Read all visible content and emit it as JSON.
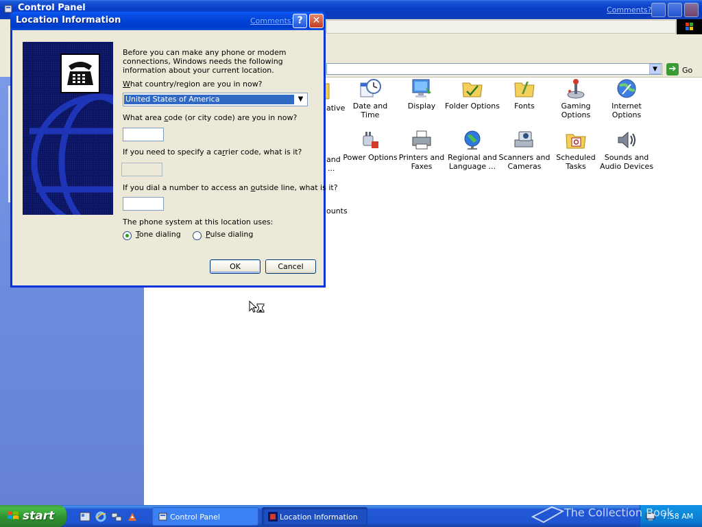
{
  "control_panel": {
    "title": "Control Panel",
    "comments_link": "Comments?",
    "go_label": "Go",
    "icons": [
      {
        "label": "Date and Time",
        "icon": "clock-icon"
      },
      {
        "label": "Display",
        "icon": "monitor-icon"
      },
      {
        "label": "Folder Options",
        "icon": "folder-icon"
      },
      {
        "label": "Fonts",
        "icon": "fonts-folder-icon"
      },
      {
        "label": "Gaming Options",
        "icon": "joystick-icon"
      },
      {
        "label": "Internet Options",
        "icon": "globe-network-icon"
      },
      {
        "label": "Power Options",
        "icon": "power-plug-icon"
      },
      {
        "label": "Printers and Faxes",
        "icon": "printer-icon"
      },
      {
        "label": "Regional and Language ...",
        "icon": "globe-icon"
      },
      {
        "label": "Scanners and Cameras",
        "icon": "scanner-icon"
      },
      {
        "label": "Scheduled Tasks",
        "icon": "calendar-folder-icon"
      },
      {
        "label": "Sounds and Audio Devices",
        "icon": "speaker-icon"
      }
    ],
    "partial_labels": {
      "row1": "ative",
      "row2a": "and",
      "row2b": "...",
      "row3": "ounts"
    }
  },
  "dialog": {
    "title": "Location Information",
    "comments_link": "Comments?",
    "help_label": "?",
    "close_label": "✕",
    "intro": "Before you can make any phone or modem connections, Windows needs the following information about your current location.",
    "country_label": {
      "pre": "",
      "key": "W",
      "post": "hat country/region are you in now?"
    },
    "country_value": "United States of America",
    "area_label": {
      "pre": "What area ",
      "key": "c",
      "post": "ode (or city code) are you in now?"
    },
    "area_value": "",
    "carrier_label": {
      "pre": "If you need to specify a ca",
      "key": "r",
      "post": "rier code, what is it?"
    },
    "carrier_value": "",
    "outside_label": {
      "pre": "If you dial a number to access an ",
      "key": "o",
      "post": "utside line, what is it?"
    },
    "outside_value": "",
    "phone_system_label": "The phone system at this location uses:",
    "tone": {
      "key": "T",
      "rest": "one dialing",
      "selected": true
    },
    "pulse": {
      "key": "P",
      "rest": "ulse dialing",
      "selected": false
    },
    "ok_label": "OK",
    "cancel_label": "Cancel"
  },
  "taskbar": {
    "start_label": "start",
    "tasks": [
      {
        "label": "Control Panel",
        "active": false
      },
      {
        "label": "Location Information",
        "active": true
      }
    ],
    "clock": "7:58 AM",
    "watermark": "The Collection Book"
  },
  "colors": {
    "xp_blue": "#0a3fc7",
    "dialog_face": "#ece9d8",
    "selection": "#316ac5",
    "start_green": "#3c9b3c"
  }
}
